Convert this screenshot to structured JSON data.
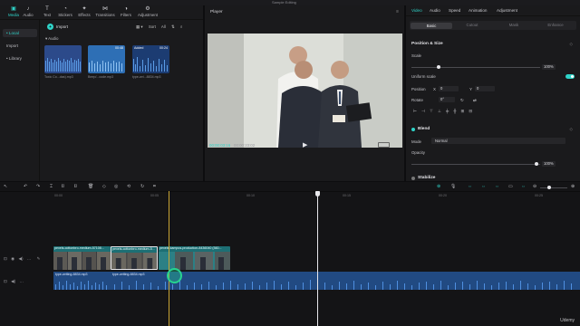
{
  "window": {
    "title": "Sample Editing"
  },
  "top_nav": [
    {
      "label": "Media",
      "icon": "media-icon",
      "active": true
    },
    {
      "label": "Audio",
      "icon": "audio-icon"
    },
    {
      "label": "Text",
      "icon": "text-icon"
    },
    {
      "label": "Stickers",
      "icon": "stickers-icon"
    },
    {
      "label": "Effects",
      "icon": "effects-icon"
    },
    {
      "label": "Transitions",
      "icon": "transitions-icon"
    },
    {
      "label": "Filters",
      "icon": "filters-icon"
    },
    {
      "label": "Adjustment",
      "icon": "adjustment-icon"
    }
  ],
  "media_sidebar": [
    {
      "label": "• Local",
      "selected": true
    },
    {
      "label": "Import"
    },
    {
      "label": "• Library"
    }
  ],
  "media": {
    "import_label": "Import",
    "tools": [
      "▦ ▾",
      "Sort",
      "All",
      "⇅",
      "⌕"
    ],
    "folder_label": "▾ Audio",
    "thumbs": [
      {
        "name": "Toxic Co...das).mp3",
        "tag": "",
        "duration": ""
      },
      {
        "name": "Beep/...code.mp3",
        "tag": "",
        "duration": "00:48"
      },
      {
        "name": "type-wri...8834.mp3",
        "tag": "Added",
        "duration": "00:24"
      }
    ]
  },
  "player": {
    "title": "Player",
    "timecode_current": "00:00:03:16",
    "timecode_total": "00:00:23:02",
    "ratio_label": "Ratio"
  },
  "inspector": {
    "tabs": [
      "Video",
      "Audio",
      "Speed",
      "Animation",
      "Adjustment"
    ],
    "active_tab": "Video",
    "subtabs": [
      "Basic",
      "Cutout",
      "Mask",
      "Enhance"
    ],
    "position_size_title": "Position & Size",
    "scale_label": "Scale",
    "scale_value": "100%",
    "uniform_scale_label": "Uniform scale",
    "position_label": "Position",
    "position_x": "0",
    "position_y": "0",
    "x_label": "X",
    "y_label": "Y",
    "rotate_label": "Rotate",
    "rotate_value": "0°",
    "blend_title": "Blend",
    "mode_label": "Mode",
    "mode_value": "Normal",
    "opacity_label": "Opacity",
    "opacity_value": "100%",
    "stabilize_title": "Stabilize",
    "accent_color": "#2fd3c8"
  },
  "timeline": {
    "ruler_ticks": [
      "00:00",
      "00:05",
      "00:10",
      "00:15",
      "00:20",
      "00:25"
    ],
    "video_clips": [
      {
        "label": "pexels-cottonbro-medium-57108..."
      },
      {
        "label": "pexels-cottonbro-medium-5...",
        "selected": true
      },
      {
        "label": "pexels-kampus-production-8436040 (360..."
      }
    ],
    "audio_clips": [
      {
        "label": "type-writing-8834.mp3"
      },
      {
        "label": "type-writing-8834.mp3"
      }
    ]
  },
  "watermark": "Udemy"
}
